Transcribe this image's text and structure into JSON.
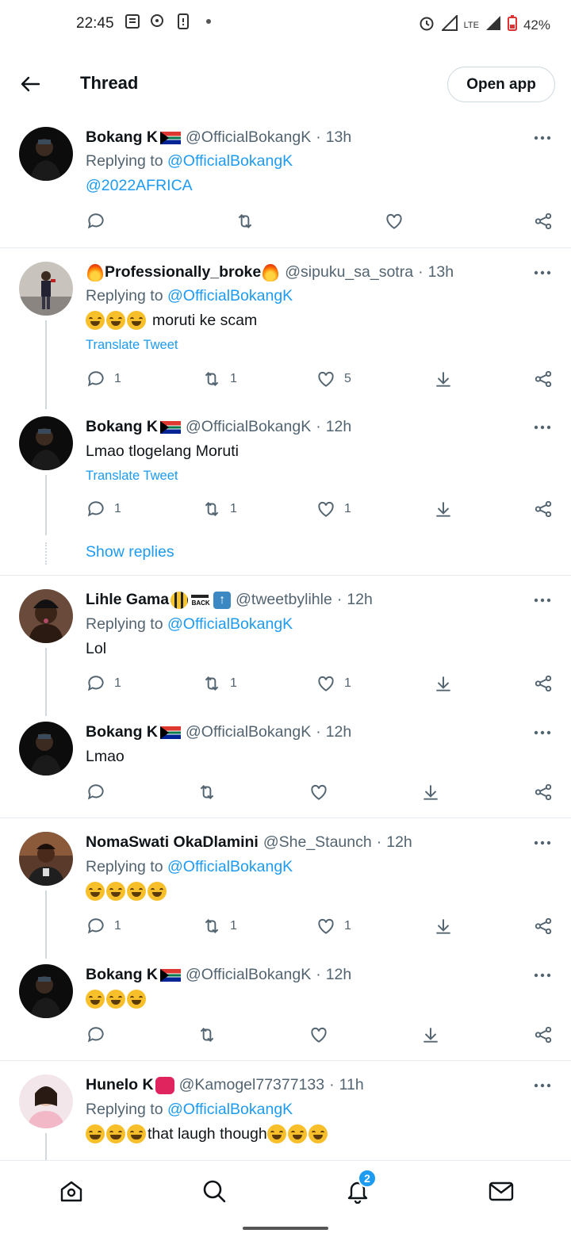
{
  "status_bar": {
    "time": "22:45",
    "network": "LTE",
    "battery": "42%"
  },
  "header": {
    "title": "Thread",
    "open_app_label": "Open app"
  },
  "translate_label": "Translate Tweet",
  "show_replies_label": "Show replies",
  "tweets": [
    {
      "name": "Bokang K",
      "handle": "@OfficialBokangK",
      "time": "13h",
      "replying_prefix": "Replying to",
      "replying_to": "@OfficialBokangK",
      "text": "@2022AFRICA",
      "reply_count": "",
      "retweet_count": "",
      "like_count": ""
    },
    {
      "name": "Professionally_broke",
      "handle": "@sipuku_sa_sotra",
      "time": "13h",
      "replying_prefix": "Replying to",
      "replying_to": "@OfficialBokangK",
      "text": "moruti ke scam",
      "reply_count": "1",
      "retweet_count": "1",
      "like_count": "5"
    },
    {
      "name": "Bokang K",
      "handle": "@OfficialBokangK",
      "time": "12h",
      "text": "Lmao tlogelang Moruti",
      "reply_count": "1",
      "retweet_count": "1",
      "like_count": "1"
    },
    {
      "name": "Lihle Gama",
      "handle": "@tweetbylihle",
      "time": "12h",
      "replying_prefix": "Replying to",
      "replying_to": "@OfficialBokangK",
      "text": "Lol",
      "reply_count": "1",
      "retweet_count": "1",
      "like_count": "1"
    },
    {
      "name": "Bokang K",
      "handle": "@OfficialBokangK",
      "time": "12h",
      "text": "Lmao"
    },
    {
      "name": "NomaSwati OkaDlamini",
      "handle": "@She_Staunch",
      "time": "12h",
      "replying_prefix": "Replying to",
      "replying_to": "@OfficialBokangK",
      "reply_count": "1",
      "retweet_count": "1",
      "like_count": "1"
    },
    {
      "name": "Bokang K",
      "handle": "@OfficialBokangK",
      "time": "12h"
    },
    {
      "name": "Hunelo K",
      "handle": "@Kamogel77377133",
      "time": "11h",
      "replying_prefix": "Replying to",
      "replying_to": "@OfficialBokangK",
      "text_middle": "that laugh though"
    }
  ],
  "bottom_nav": {
    "items": [
      "home-icon",
      "search-icon",
      "notifications-icon",
      "messages-icon"
    ],
    "notification_badge": "2"
  },
  "colors": {
    "link": "#1d9bf0",
    "text": "#0f1419",
    "secondary": "#536471",
    "border": "#cfd9de"
  }
}
